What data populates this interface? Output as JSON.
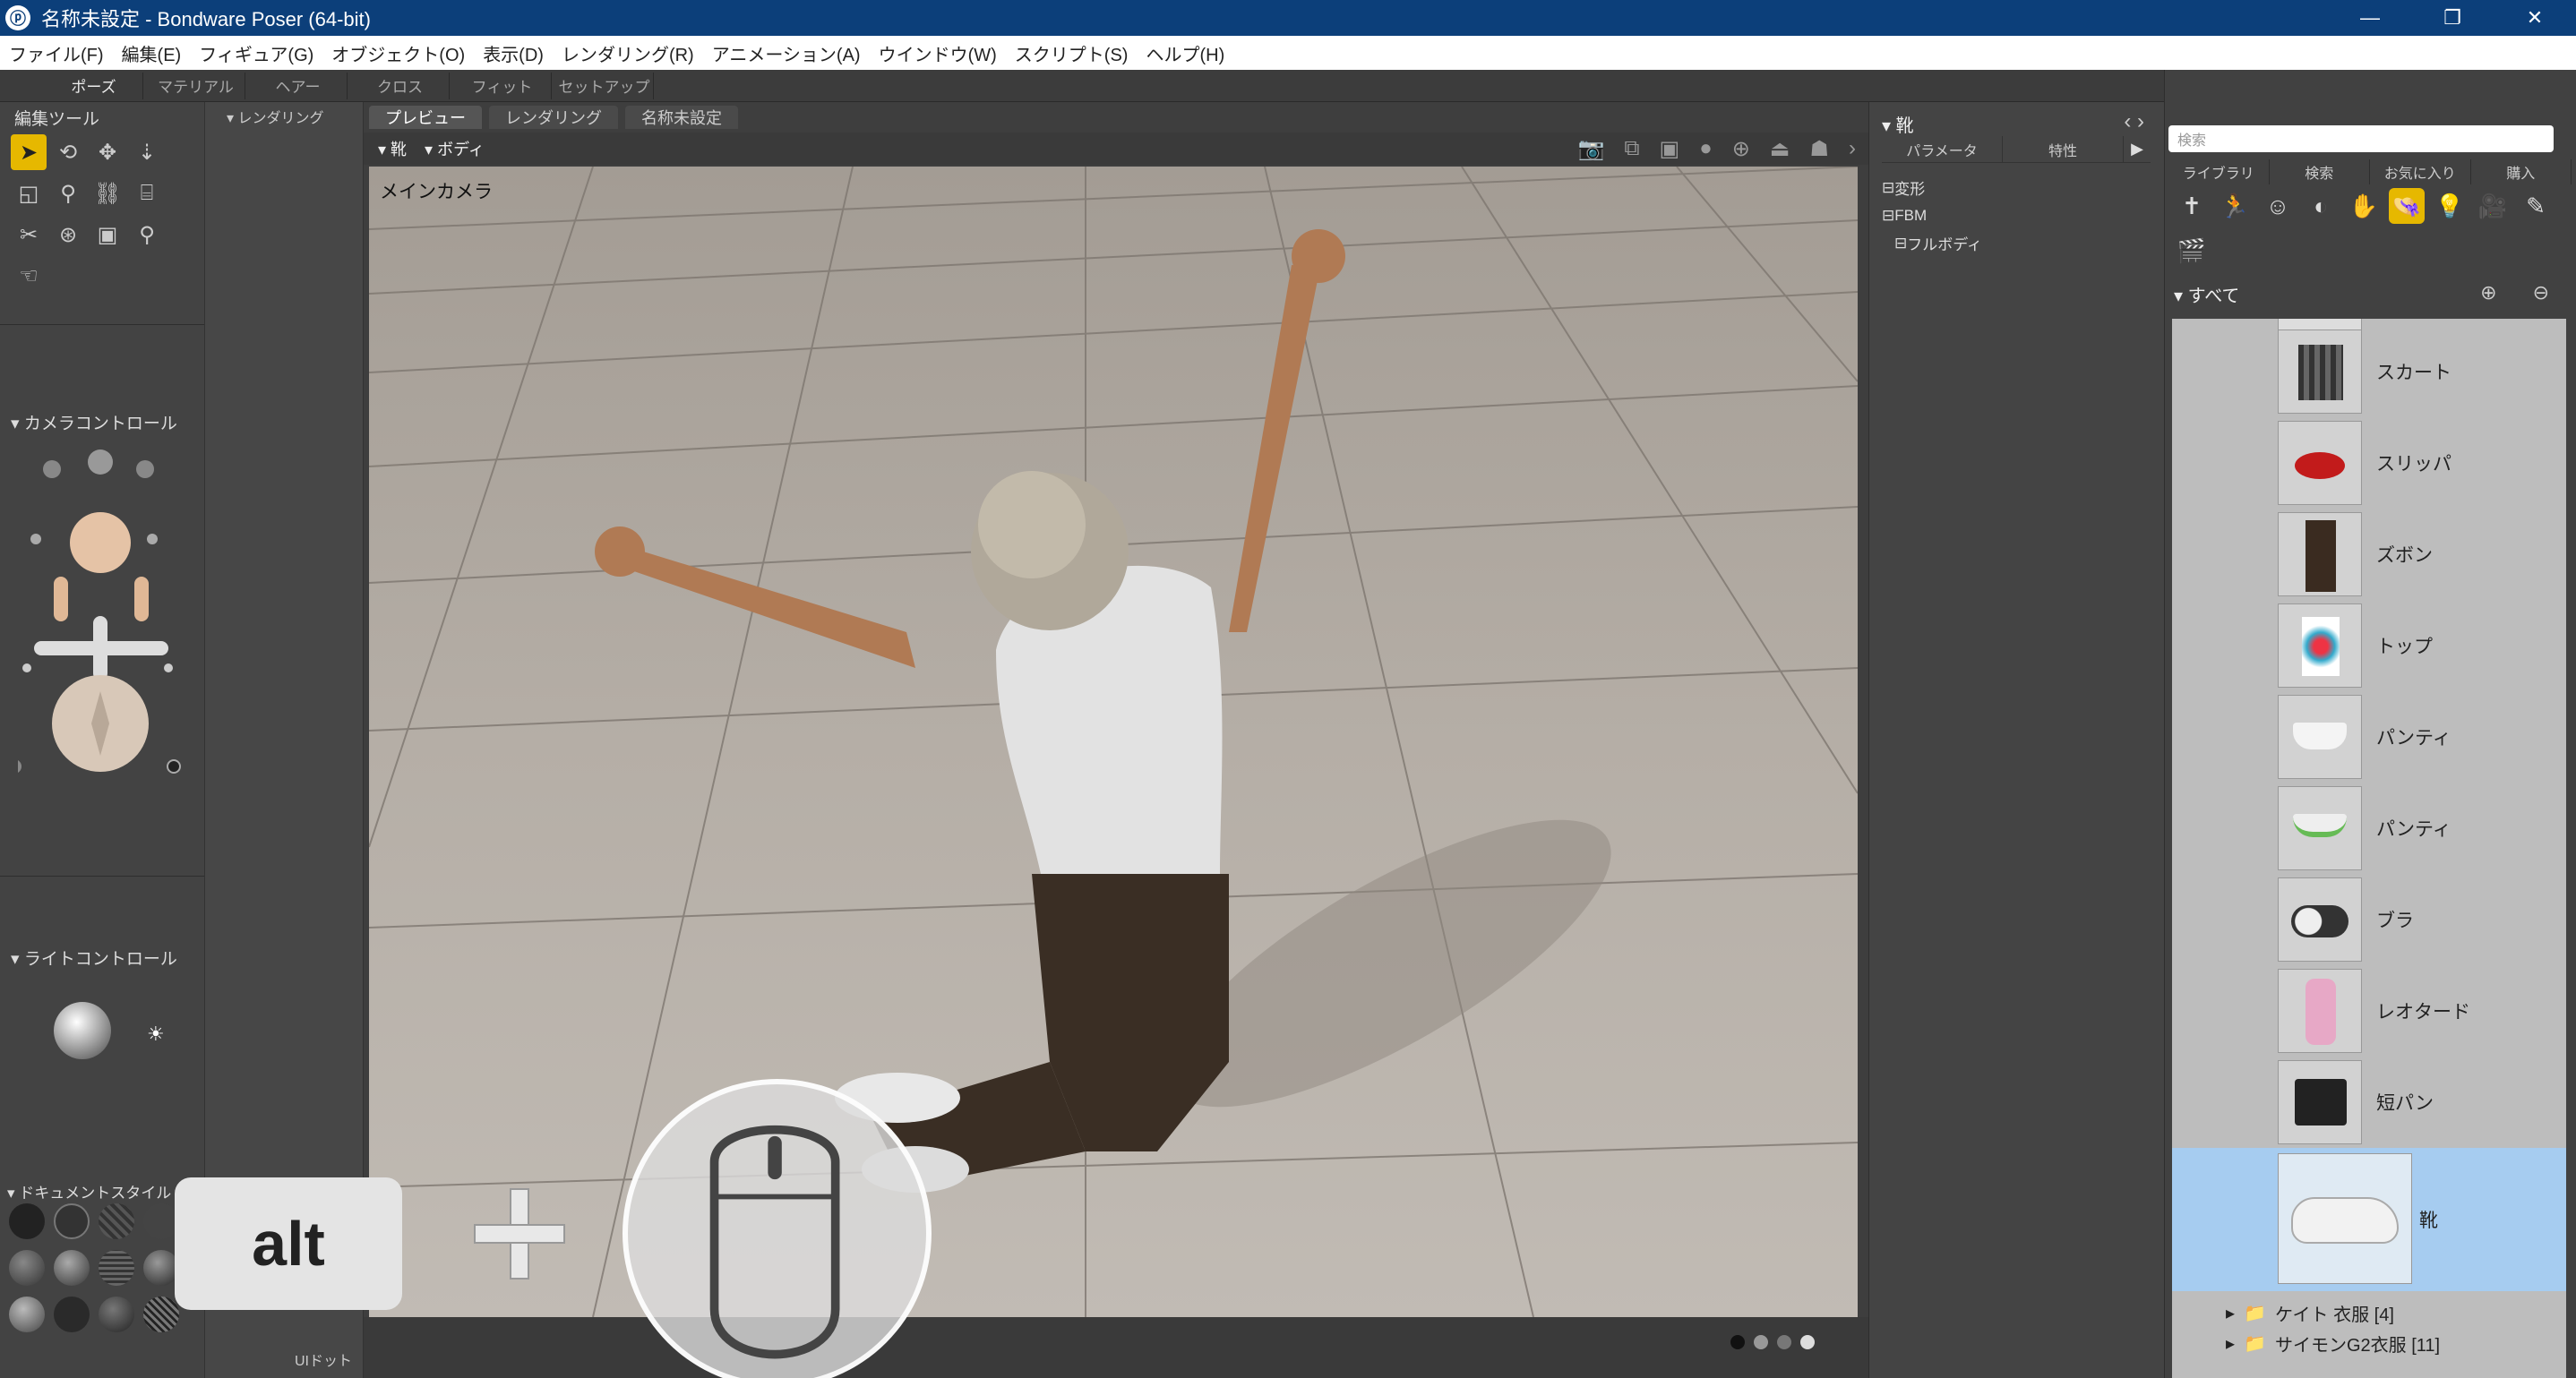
{
  "window": {
    "title": "名称未設定 - Bondware Poser (64-bit)",
    "minimize": "—",
    "maximize": "❐",
    "close": "✕"
  },
  "menu": [
    "ファイル(F)",
    "編集(E)",
    "フィギュア(G)",
    "オブジェクト(O)",
    "表示(D)",
    "レンダリング(R)",
    "アニメーション(A)",
    "ウインドウ(W)",
    "スクリプト(S)",
    "ヘルプ(H)"
  ],
  "rooms": [
    "ポーズ",
    "マテリアル",
    "ヘアー",
    "クロス",
    "フィット",
    "セットアップ"
  ],
  "left_panel": {
    "edit_tools": "編集ツール",
    "camera_control": "カメラコントロール",
    "light_control": "ライトコントロール",
    "document_style": "ドキュメントスタイル"
  },
  "col2": {
    "render_header": "レンダリング",
    "ui_dots": "UIドット"
  },
  "viewport": {
    "tabs": [
      "プレビュー",
      "レンダリング",
      "名称未設定"
    ],
    "figure_select": "靴",
    "part_select": "ボディ",
    "camera_label": "メインカメラ"
  },
  "params": {
    "title": "靴",
    "tabs": [
      "パラメータ",
      "特性"
    ],
    "tree": [
      "変形",
      "FBM",
      "フルボディ"
    ]
  },
  "library": {
    "search_placeholder": "検索",
    "tabs": [
      "ライブラリ",
      "検索",
      "お気に入り",
      "購入"
    ],
    "all_label": "すべて",
    "items": [
      {
        "label": "スカート"
      },
      {
        "label": "スリッパ"
      },
      {
        "label": "ズボン"
      },
      {
        "label": "トップ"
      },
      {
        "label": "パンティ"
      },
      {
        "label": "パンティ"
      },
      {
        "label": "ブラ"
      },
      {
        "label": "レオタード"
      },
      {
        "label": "短パン"
      },
      {
        "label": "靴",
        "selected": true
      }
    ],
    "folders": [
      "ケイト 衣服 [4]",
      "サイモンG2衣服 [11]"
    ]
  },
  "overlay": {
    "key": "alt"
  },
  "colors": {
    "accent": "#e6b800",
    "titlebar": "#0c3f7a",
    "selected": "#a6ccf0"
  }
}
